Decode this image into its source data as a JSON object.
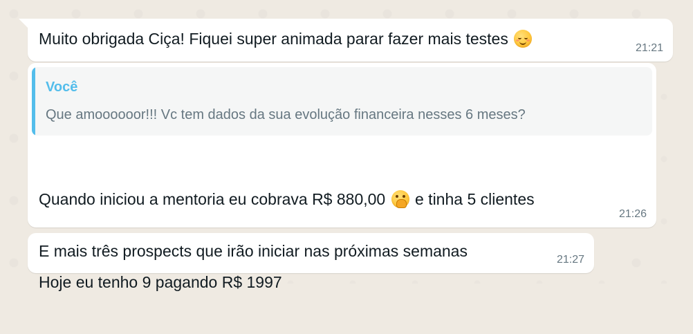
{
  "messages": [
    {
      "text": "Muito obrigada Ciça! Fiquei super animada parar fazer mais testes",
      "emoji": "smiling-face-icon",
      "time": "21:21"
    },
    {
      "quote": {
        "author": "Você",
        "text": "Que amoooooor!!! Vc tem dados da sua evolução financeira nesses 6 meses?"
      },
      "line1_before": "Quando iniciou a mentoria eu cobrava R$ 880,00",
      "line1_emoji": "face-with-hand-over-mouth-icon",
      "line1_after": "e tinha 5 clientes",
      "line2": "Hoje eu tenho 9 pagando R$ 1997",
      "time": "21:26"
    },
    {
      "text": "E mais três prospects que irão iniciar nas próximas semanas",
      "time": "21:27"
    }
  ],
  "colors": {
    "background": "#efeae2",
    "bubble": "#ffffff",
    "quote_accent": "#53bdeb",
    "timestamp": "#667781",
    "text": "#111b21"
  }
}
